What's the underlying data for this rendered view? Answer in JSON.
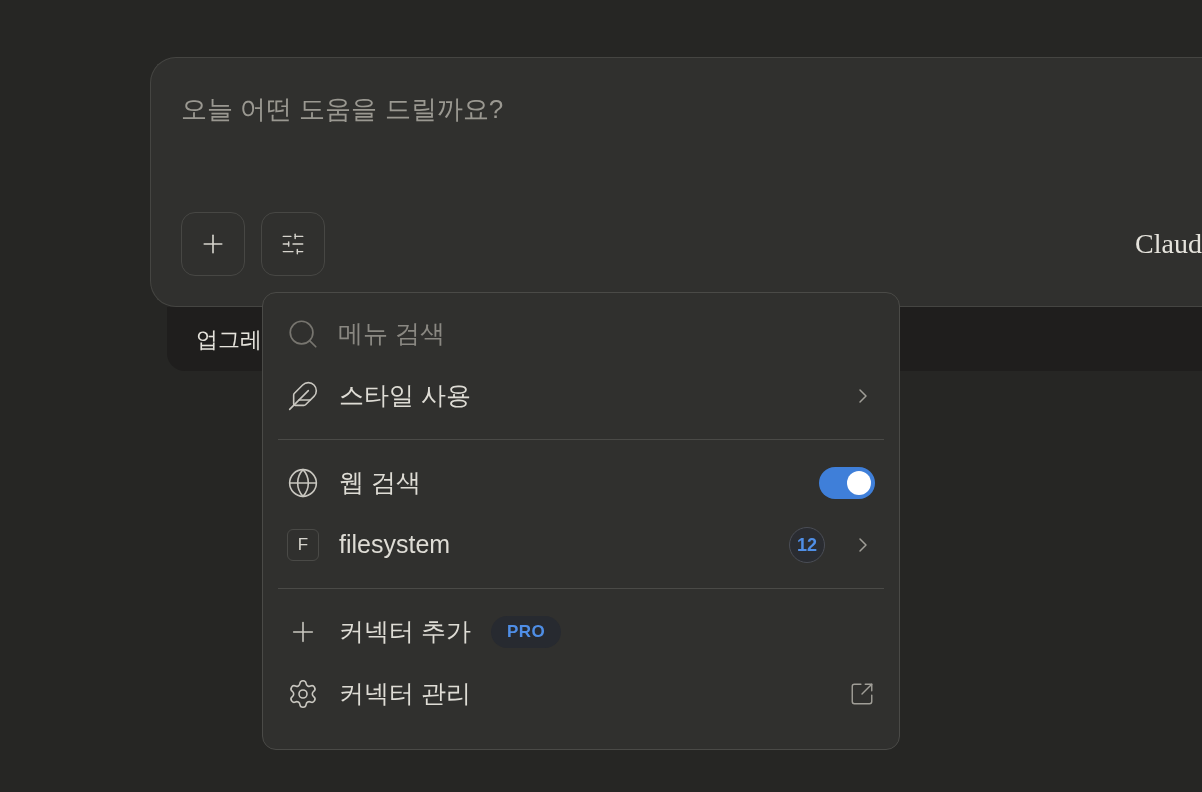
{
  "composer": {
    "placeholder": "오늘 어떤 도움을 드릴까요?",
    "model_label": "Claud"
  },
  "upgrade_bar": {
    "text": "업그레"
  },
  "menu": {
    "search": {
      "placeholder": "메뉴 검색"
    },
    "sections": [
      [
        {
          "kind": "submenu",
          "label": "스타일 사용"
        }
      ],
      [
        {
          "kind": "toggle",
          "label": "웹 검색",
          "on": true
        },
        {
          "kind": "connector",
          "icon_letter": "F",
          "label": "filesystem",
          "count": "12"
        }
      ],
      [
        {
          "kind": "action",
          "label": "커넥터 추가",
          "badge": "PRO"
        },
        {
          "kind": "link",
          "label": "커넥터 관리"
        }
      ]
    ]
  }
}
